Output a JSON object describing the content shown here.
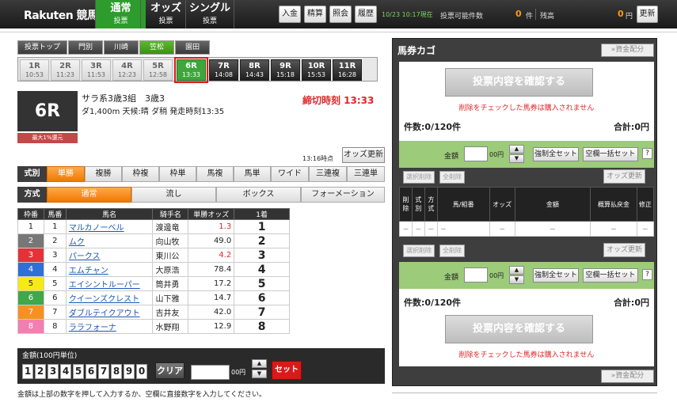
{
  "header": {
    "logo": "Rakuten 競馬",
    "tabs": [
      {
        "top": "通常",
        "bottom": "投票"
      },
      {
        "top": "オッズ",
        "bottom": "投票"
      },
      {
        "top": "シングル",
        "bottom": "投票"
      }
    ],
    "buttons": [
      "入金",
      "精算",
      "照会",
      "履歴"
    ],
    "datetime": "10/23 10:17現在",
    "available_label": "投票可能件数",
    "available_count": "0",
    "available_unit": "件",
    "balance_label": "残高",
    "balance": "0",
    "balance_unit": "円",
    "refresh": "更新"
  },
  "venues": [
    "投票トップ",
    "門別",
    "川崎",
    "笠松",
    "園田"
  ],
  "races": [
    {
      "num": "1R",
      "time": "10:53"
    },
    {
      "num": "2R",
      "time": "11:23"
    },
    {
      "num": "3R",
      "time": "11:53"
    },
    {
      "num": "4R",
      "time": "12:23"
    },
    {
      "num": "5R",
      "time": "12:58"
    },
    {
      "num": "6R",
      "time": "13:33"
    },
    {
      "num": "7R",
      "time": "14:08"
    },
    {
      "num": "8R",
      "time": "14:43"
    },
    {
      "num": "9R",
      "time": "15:18"
    },
    {
      "num": "10R",
      "time": "15:53"
    },
    {
      "num": "11R",
      "time": "16:28"
    }
  ],
  "race": {
    "number": "6R",
    "badge": "最大1%還元",
    "name": "サラ系3歳3組　3歳3",
    "info": "ダ1,400m  天候:晴 ダ稍  発走時刻13:35",
    "deadline": "締切時刻 13:33",
    "odds_time": "13:16時点",
    "odds_update": "オッズ更新"
  },
  "bet_types": {
    "label": "式別",
    "items": [
      "単勝",
      "複勝",
      "枠複",
      "枠単",
      "馬複",
      "馬単",
      "ワイド",
      "三連複",
      "三連単"
    ]
  },
  "methods": {
    "label": "方式",
    "items": [
      "通常",
      "流し",
      "ボックス",
      "フォーメーション"
    ]
  },
  "table": {
    "headers": [
      "枠番",
      "馬番",
      "馬名",
      "騎手名",
      "単勝オッズ",
      "1着"
    ],
    "rows": [
      {
        "waku": "1",
        "uma": "1",
        "name": "マルカノーベル",
        "jockey": "渡邊竜",
        "odds": "1.3",
        "pos": "1"
      },
      {
        "waku": "2",
        "uma": "2",
        "name": "ムク",
        "jockey": "向山牧",
        "odds": "49.0",
        "pos": "2"
      },
      {
        "waku": "3",
        "uma": "3",
        "name": "パークス",
        "jockey": "東川公",
        "odds": "4.2",
        "pos": "3"
      },
      {
        "waku": "4",
        "uma": "4",
        "name": "エムチャン",
        "jockey": "大原浩",
        "odds": "78.4",
        "pos": "4"
      },
      {
        "waku": "5",
        "uma": "5",
        "name": "エイシントルーパー",
        "jockey": "筒井勇",
        "odds": "17.2",
        "pos": "5"
      },
      {
        "waku": "6",
        "uma": "6",
        "name": "クイーンズクレスト",
        "jockey": "山下雅",
        "odds": "14.7",
        "pos": "6"
      },
      {
        "waku": "7",
        "uma": "7",
        "name": "ダブルテイクアウト",
        "jockey": "吉井友",
        "odds": "42.0",
        "pos": "7"
      },
      {
        "waku": "8",
        "uma": "8",
        "name": "ララフォーナ",
        "jockey": "水野翔",
        "odds": "12.9",
        "pos": "8"
      }
    ]
  },
  "amount": {
    "label": "金額(100円単位)",
    "keys": [
      "1",
      "2",
      "3",
      "4",
      "5",
      "6",
      "7",
      "8",
      "9",
      "0"
    ],
    "clear": "クリア",
    "unit": "00円",
    "set": "セット",
    "up": "▲",
    "down": "▼"
  },
  "help": "金額は上部の数字を押して入力するか、空欄に直接数字を入力してください。",
  "cart": {
    "title": "馬券カゴ",
    "alloc": "»資金配分",
    "confirm": "投票内容を確認する",
    "warning": "削除をチェックした馬券は購入されません",
    "count": "件数:0/120件",
    "total": "合計:0円",
    "amount_label": "金額",
    "amount_unit": "00円",
    "force_set": "強制全セット",
    "batch_set": "空欄一括セット",
    "help": "?",
    "select_delete": "選択削除",
    "all_delete": "全削除",
    "odds_update": "オッズ更新",
    "headers": [
      "削除",
      "式別",
      "方式",
      "馬/組番",
      "オッズ",
      "金額",
      "概算払戻金",
      "修正"
    ],
    "empty_row": [
      "－",
      "－",
      "－",
      "－",
      "－",
      "－",
      "－",
      "－"
    ]
  }
}
